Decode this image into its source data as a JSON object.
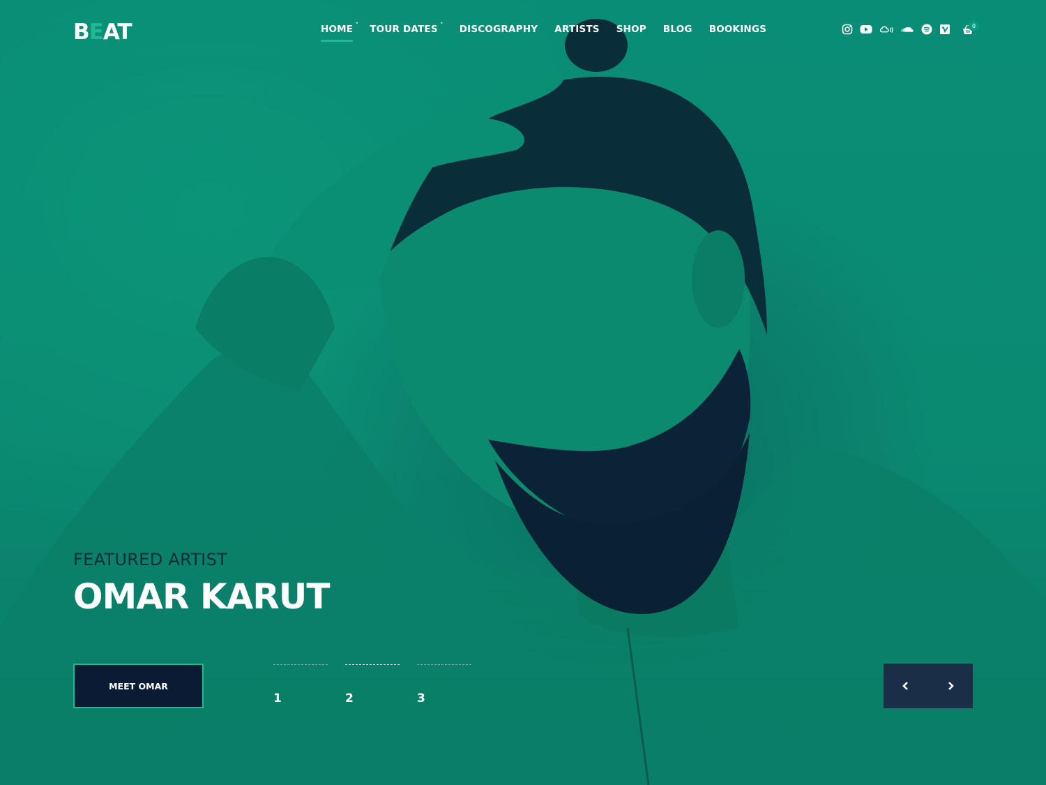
{
  "brand": {
    "logo_parts": [
      "B",
      "E",
      "AT"
    ],
    "accent_color": "#21b892"
  },
  "nav": {
    "items": [
      {
        "label": "HOME",
        "has_dropdown": true,
        "active": true
      },
      {
        "label": "TOUR DATES",
        "has_dropdown": true,
        "active": false
      },
      {
        "label": "DISCOGRAPHY",
        "has_dropdown": false,
        "active": false
      },
      {
        "label": "ARTISTS",
        "has_dropdown": false,
        "active": false
      },
      {
        "label": "SHOP",
        "has_dropdown": false,
        "active": false
      },
      {
        "label": "BLOG",
        "has_dropdown": false,
        "active": false
      },
      {
        "label": "BOOKINGS",
        "has_dropdown": false,
        "active": false
      }
    ],
    "caret": "˅"
  },
  "social": [
    "instagram-icon",
    "youtube-icon",
    "mixcloud-icon",
    "soundcloud-icon",
    "spotify-icon",
    "vimeo-icon"
  ],
  "cart": {
    "icon": "basket-icon",
    "count": "0"
  },
  "hero": {
    "subtitle": "FEATURED ARTIST",
    "title": "OMAR KARUT",
    "cta_label": "MEET OMAR",
    "background_color": "#0b8a72",
    "text_dark_color": "#0a2a3a"
  },
  "slider": {
    "slides": [
      "1",
      "2",
      "3"
    ],
    "active_index": 1,
    "prev_icon": "chevron-left-icon",
    "next_icon": "chevron-right-icon"
  }
}
